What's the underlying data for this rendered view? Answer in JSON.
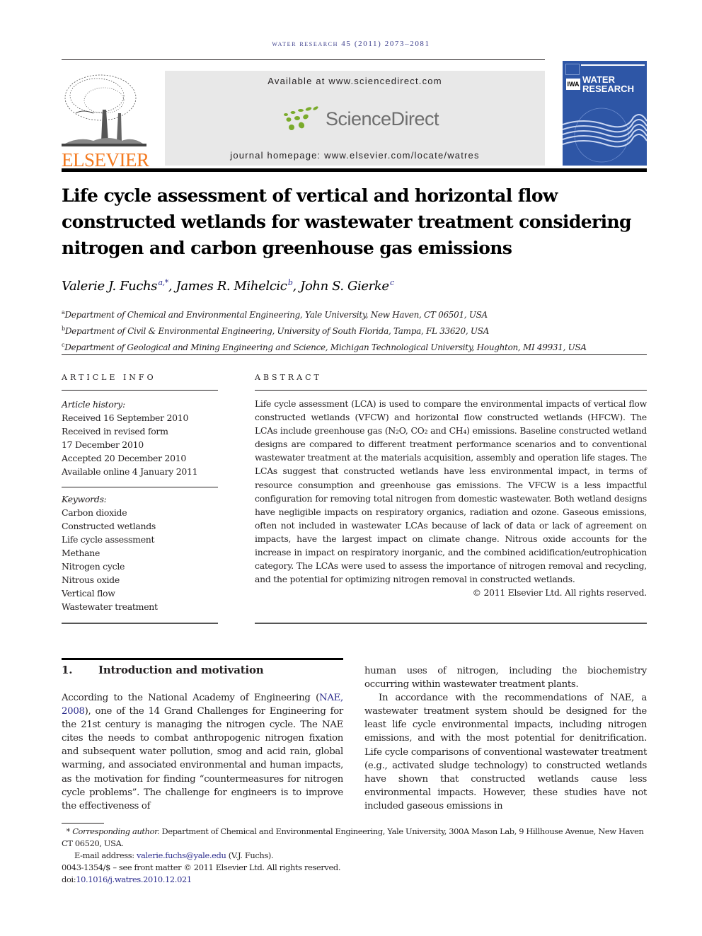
{
  "journal": {
    "running_head": "water research 45 (2011) 2073–2081",
    "publisher": "ELSEVIER",
    "available_at": "Available at www.sciencedirect.com",
    "sd_brand": "ScienceDirect",
    "homepage": "journal homepage: www.elsevier.com/locate/watres",
    "cover_title_1": "WATER",
    "cover_title_2": "RESEARCH",
    "cover_badge": "IWA",
    "colors": {
      "elsevier_orange": "#f47a20",
      "sd_green": "#7aab2b",
      "cover_blue": "#2e56a6",
      "link_blue": "#2b2b8c"
    }
  },
  "article": {
    "title": "Life cycle assessment of vertical and horizontal flow constructed wetlands for wastewater treatment considering nitrogen and carbon greenhouse gas emissions",
    "authors": [
      {
        "name": "Valerie J. Fuchs",
        "sup": "a,*"
      },
      {
        "name": "James R. Mihelcic",
        "sup": "b"
      },
      {
        "name": "John S. Gierke",
        "sup": "c"
      }
    ],
    "affiliations": [
      {
        "mark": "a",
        "text": "Department of Chemical and Environmental Engineering, Yale University, New Haven, CT 06501, USA"
      },
      {
        "mark": "b",
        "text": "Department of Civil & Environmental Engineering, University of South Florida, Tampa, FL 33620, USA"
      },
      {
        "mark": "c",
        "text": "Department of Geological and Mining Engineering and Science, Michigan Technological University, Houghton, MI 49931, USA"
      }
    ]
  },
  "article_info": {
    "heading": "ARTICLE INFO",
    "history_label": "Article history:",
    "history": [
      "Received 16 September 2010",
      "Received in revised form",
      "17 December 2010",
      "Accepted 20 December 2010",
      "Available online 4 January 2011"
    ],
    "keywords_label": "Keywords:",
    "keywords": [
      "Carbon dioxide",
      "Constructed wetlands",
      "Life cycle assessment",
      "Methane",
      "Nitrogen cycle",
      "Nitrous oxide",
      "Vertical flow",
      "Wastewater treatment"
    ]
  },
  "abstract": {
    "heading": "ABSTRACT",
    "p1": "Life cycle assessment (LCA) is used to compare the environmental impacts of vertical flow constructed wetlands (VFCW) and horizontal flow constructed wetlands (HFCW). The LCAs include greenhouse gas (",
    "n2o": "N₂O",
    "sep1": ", ",
    "co2": "CO₂",
    "sep2": " and ",
    "ch4": "CH₄",
    "p2": ") emissions. Baseline constructed wetland designs are compared to different treatment performance scenarios and to conventional wastewater treatment at the materials acquisition, assembly and operation life stages. The LCAs suggest that constructed wetlands have less environmental impact, in terms of resource consumption and greenhouse gas emissions. The VFCW is a less impactful configuration for removing total nitrogen from domestic wastewater. Both wetland designs have negligible impacts on respiratory organics, radiation and ozone. Gaseous emissions, often not included in wastewater LCAs because of lack of data or lack of agreement on impacts, have the largest impact on climate change. Nitrous oxide accounts for the increase in impact on respiratory inorganic, and the combined acidification/eutrophication category. The LCAs were used to assess the importance of nitrogen removal and recycling, and the potential for optimizing nitrogen removal in constructed wetlands.",
    "copyright": "© 2011 Elsevier Ltd. All rights reserved."
  },
  "intro": {
    "number": "1.",
    "title": "Introduction and motivation",
    "left_a": "According to the National Academy of Engineering (",
    "left_link": "NAE, 2008",
    "left_b": "), one of the 14 Grand Challenges for Engineering for the 21st century is managing the nitrogen cycle. The NAE cites the needs to combat anthropogenic nitrogen fixation and subsequent water pollution, smog and acid rain, global warming, and associated environmental and human impacts, as the motivation for finding “countermeasures for nitrogen cycle problems”. The challenge for engineers is to improve the effectiveness of",
    "right_p1": "human uses of nitrogen, including the biochemistry occurring within wastewater treatment plants.",
    "right_p2": "In accordance with the recommendations of NAE, a wastewater treatment system should be designed for the least life cycle environmental impacts, including nitrogen emissions, and with the most potential for denitrification. Life cycle comparisons of conventional wastewater treatment (e.g., activated sludge technology) to constructed wetlands have shown that constructed wetlands cause less environmental impacts. However, these studies have not included gaseous emissions in"
  },
  "footnotes": {
    "star": "*",
    "corr_label": "Corresponding author.",
    "corr_text": " Department of Chemical and Environmental Engineering, Yale University, 300A Mason Lab, 9 Hillhouse Avenue, New Haven CT 06520, USA.",
    "email_label": "E-mail address: ",
    "email": "valerie.fuchs@yale.edu",
    "email_suffix": " (V.J. Fuchs).",
    "front_matter": "0043-1354/$ – see front matter © 2011 Elsevier Ltd. All rights reserved.",
    "doi_label": "doi:",
    "doi": "10.1016/j.watres.2010.12.021"
  }
}
